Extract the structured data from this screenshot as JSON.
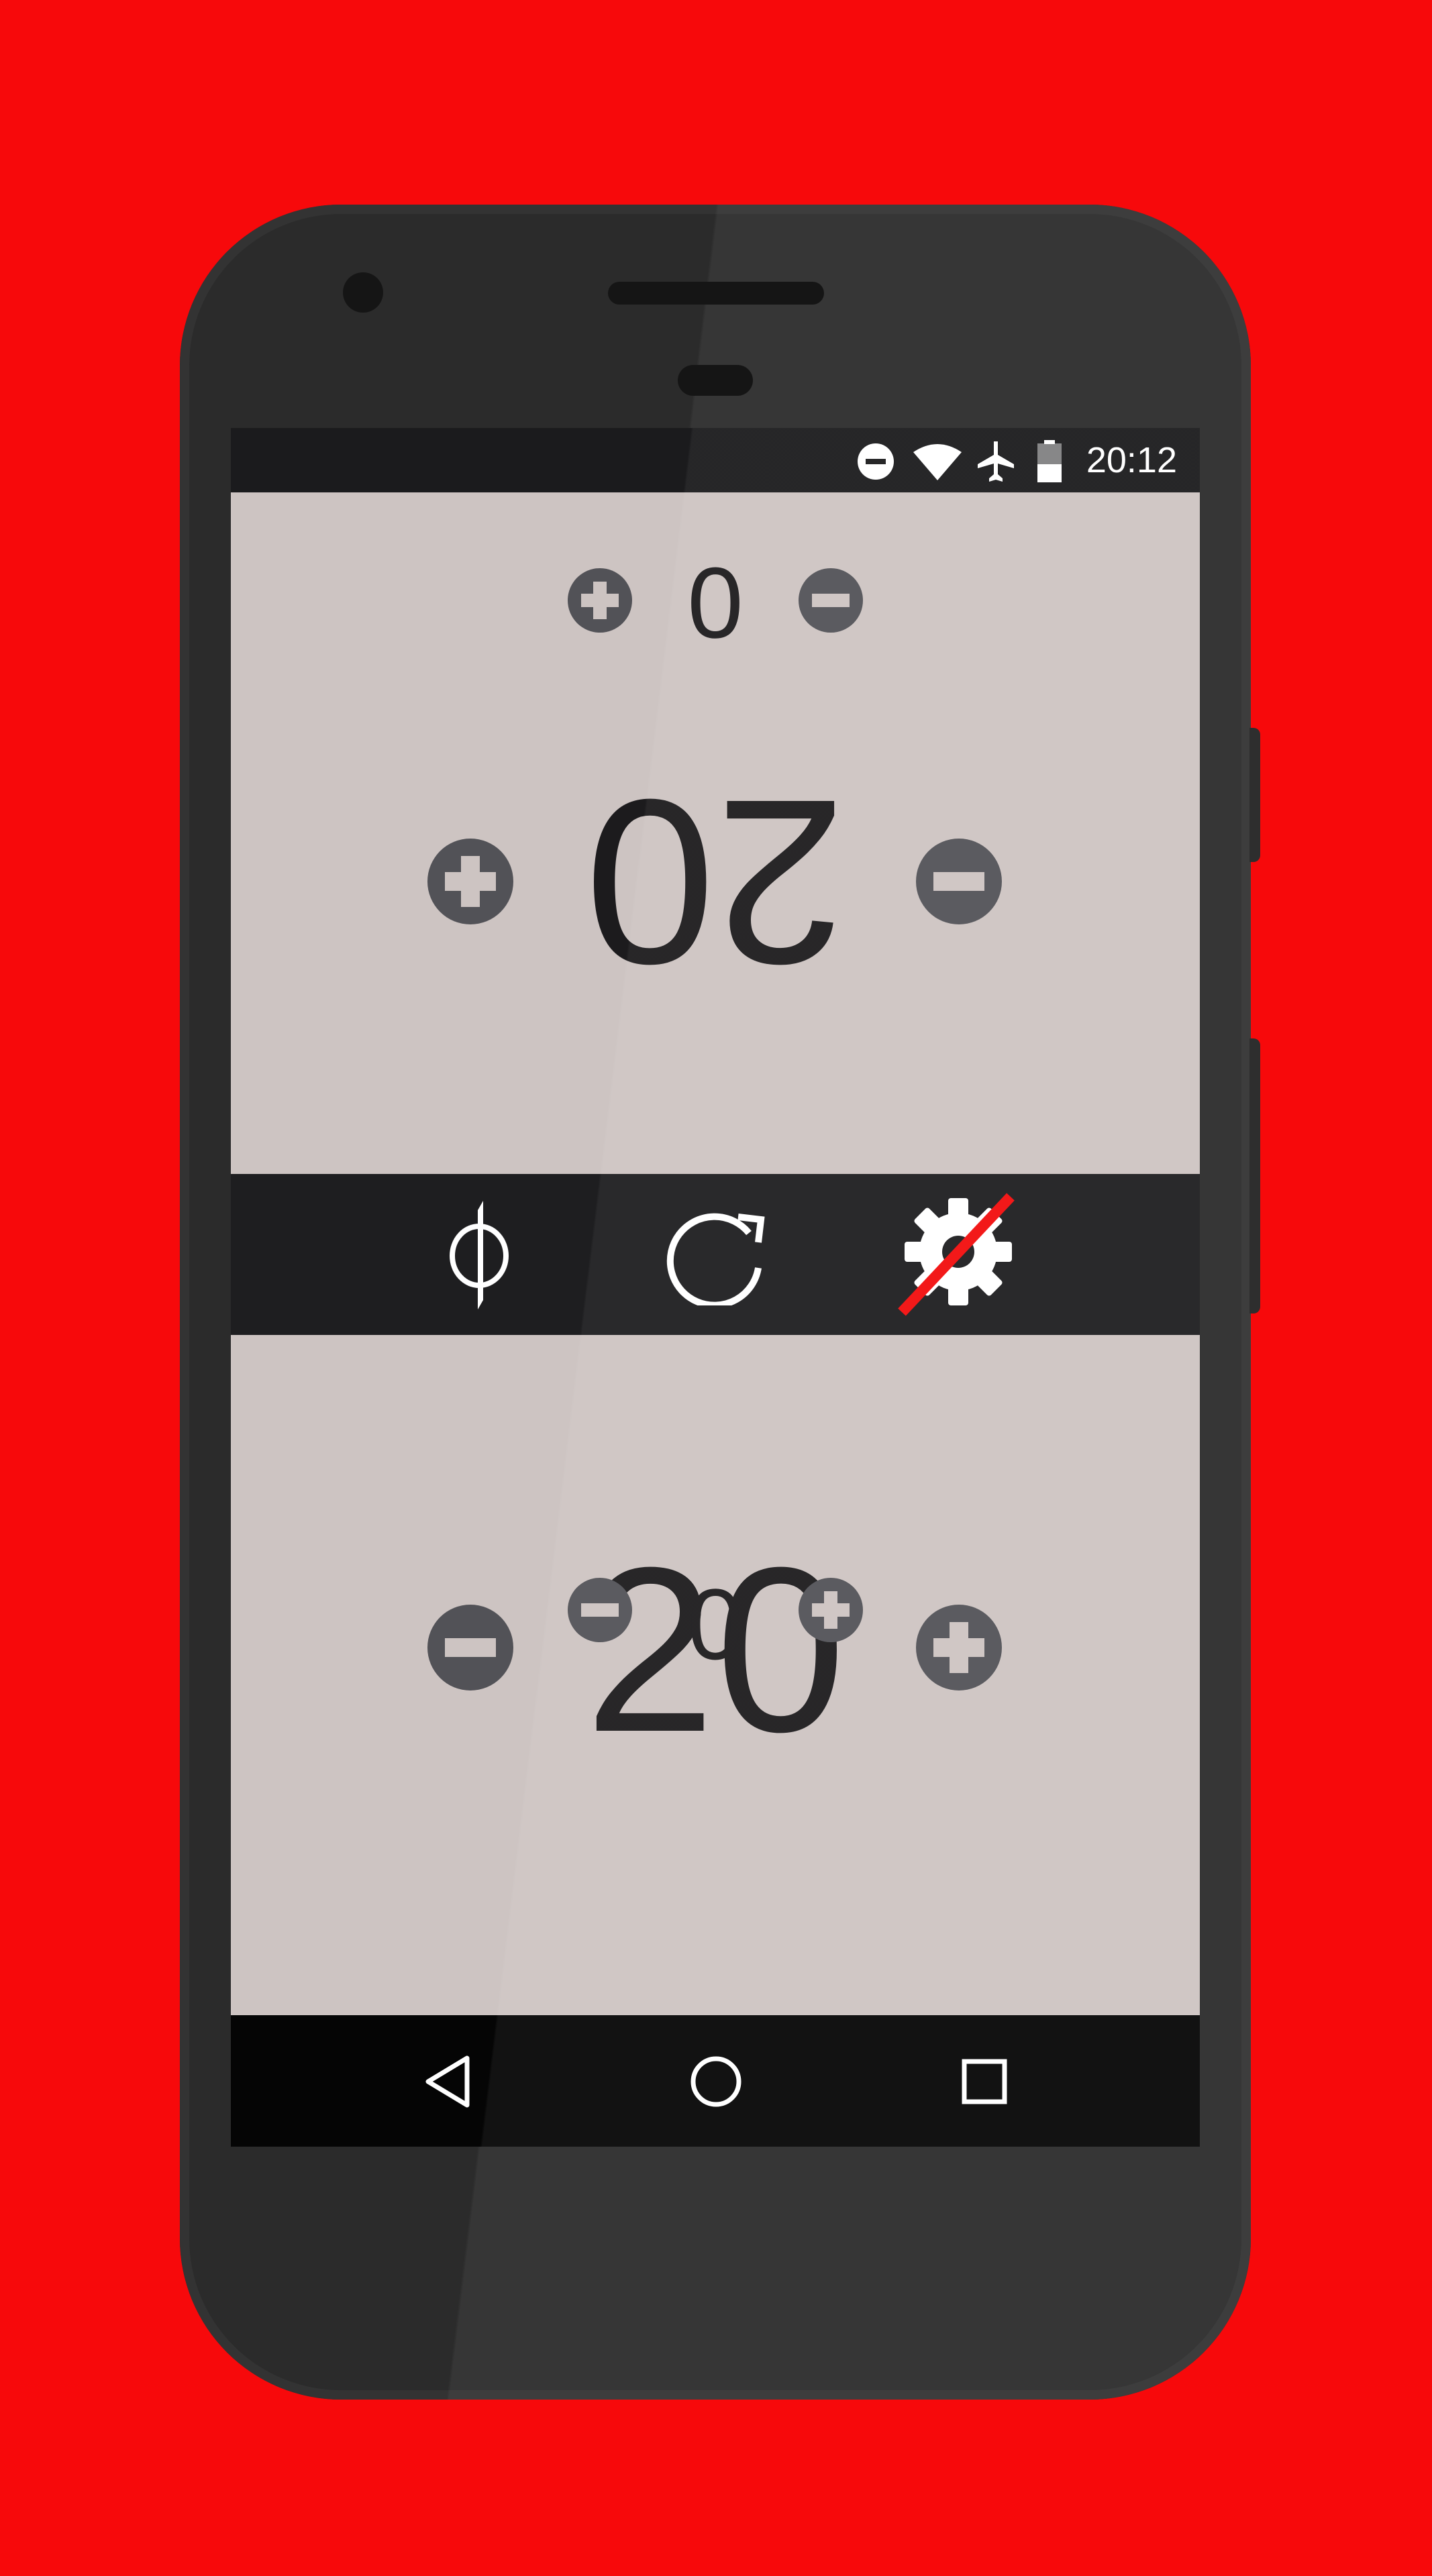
{
  "status_bar": {
    "time": "20:12",
    "icons": [
      "do-not-disturb-icon",
      "wifi-icon",
      "airplane-mode-icon",
      "battery-icon"
    ]
  },
  "top_player": {
    "orientation": "rotated-180",
    "life_total": "20",
    "counter": "0",
    "buttons": {
      "life_increase": "plus-icon",
      "life_decrease": "minus-icon",
      "counter_increase": "plus-icon",
      "counter_decrease": "minus-icon"
    }
  },
  "toolbar": {
    "items": [
      {
        "name": "phi-icon"
      },
      {
        "name": "reset-icon"
      },
      {
        "name": "settings-disabled-icon"
      }
    ]
  },
  "bottom_player": {
    "orientation": "upright",
    "life_total": "20",
    "counter": "0",
    "buttons": {
      "life_decrease": "minus-icon",
      "life_increase": "plus-icon",
      "counter_decrease": "minus-icon",
      "counter_increase": "plus-icon"
    }
  },
  "nav_bar": {
    "items": [
      "back-icon",
      "home-icon",
      "recents-icon"
    ]
  },
  "colors": {
    "background": "#f7090b",
    "phone_body": "#2b2b2b",
    "screen": "#cdc4c2",
    "toolbar": "#1e1e20",
    "button": "#525257",
    "text": "#1c1b1d",
    "slash": "#f20d0d"
  }
}
